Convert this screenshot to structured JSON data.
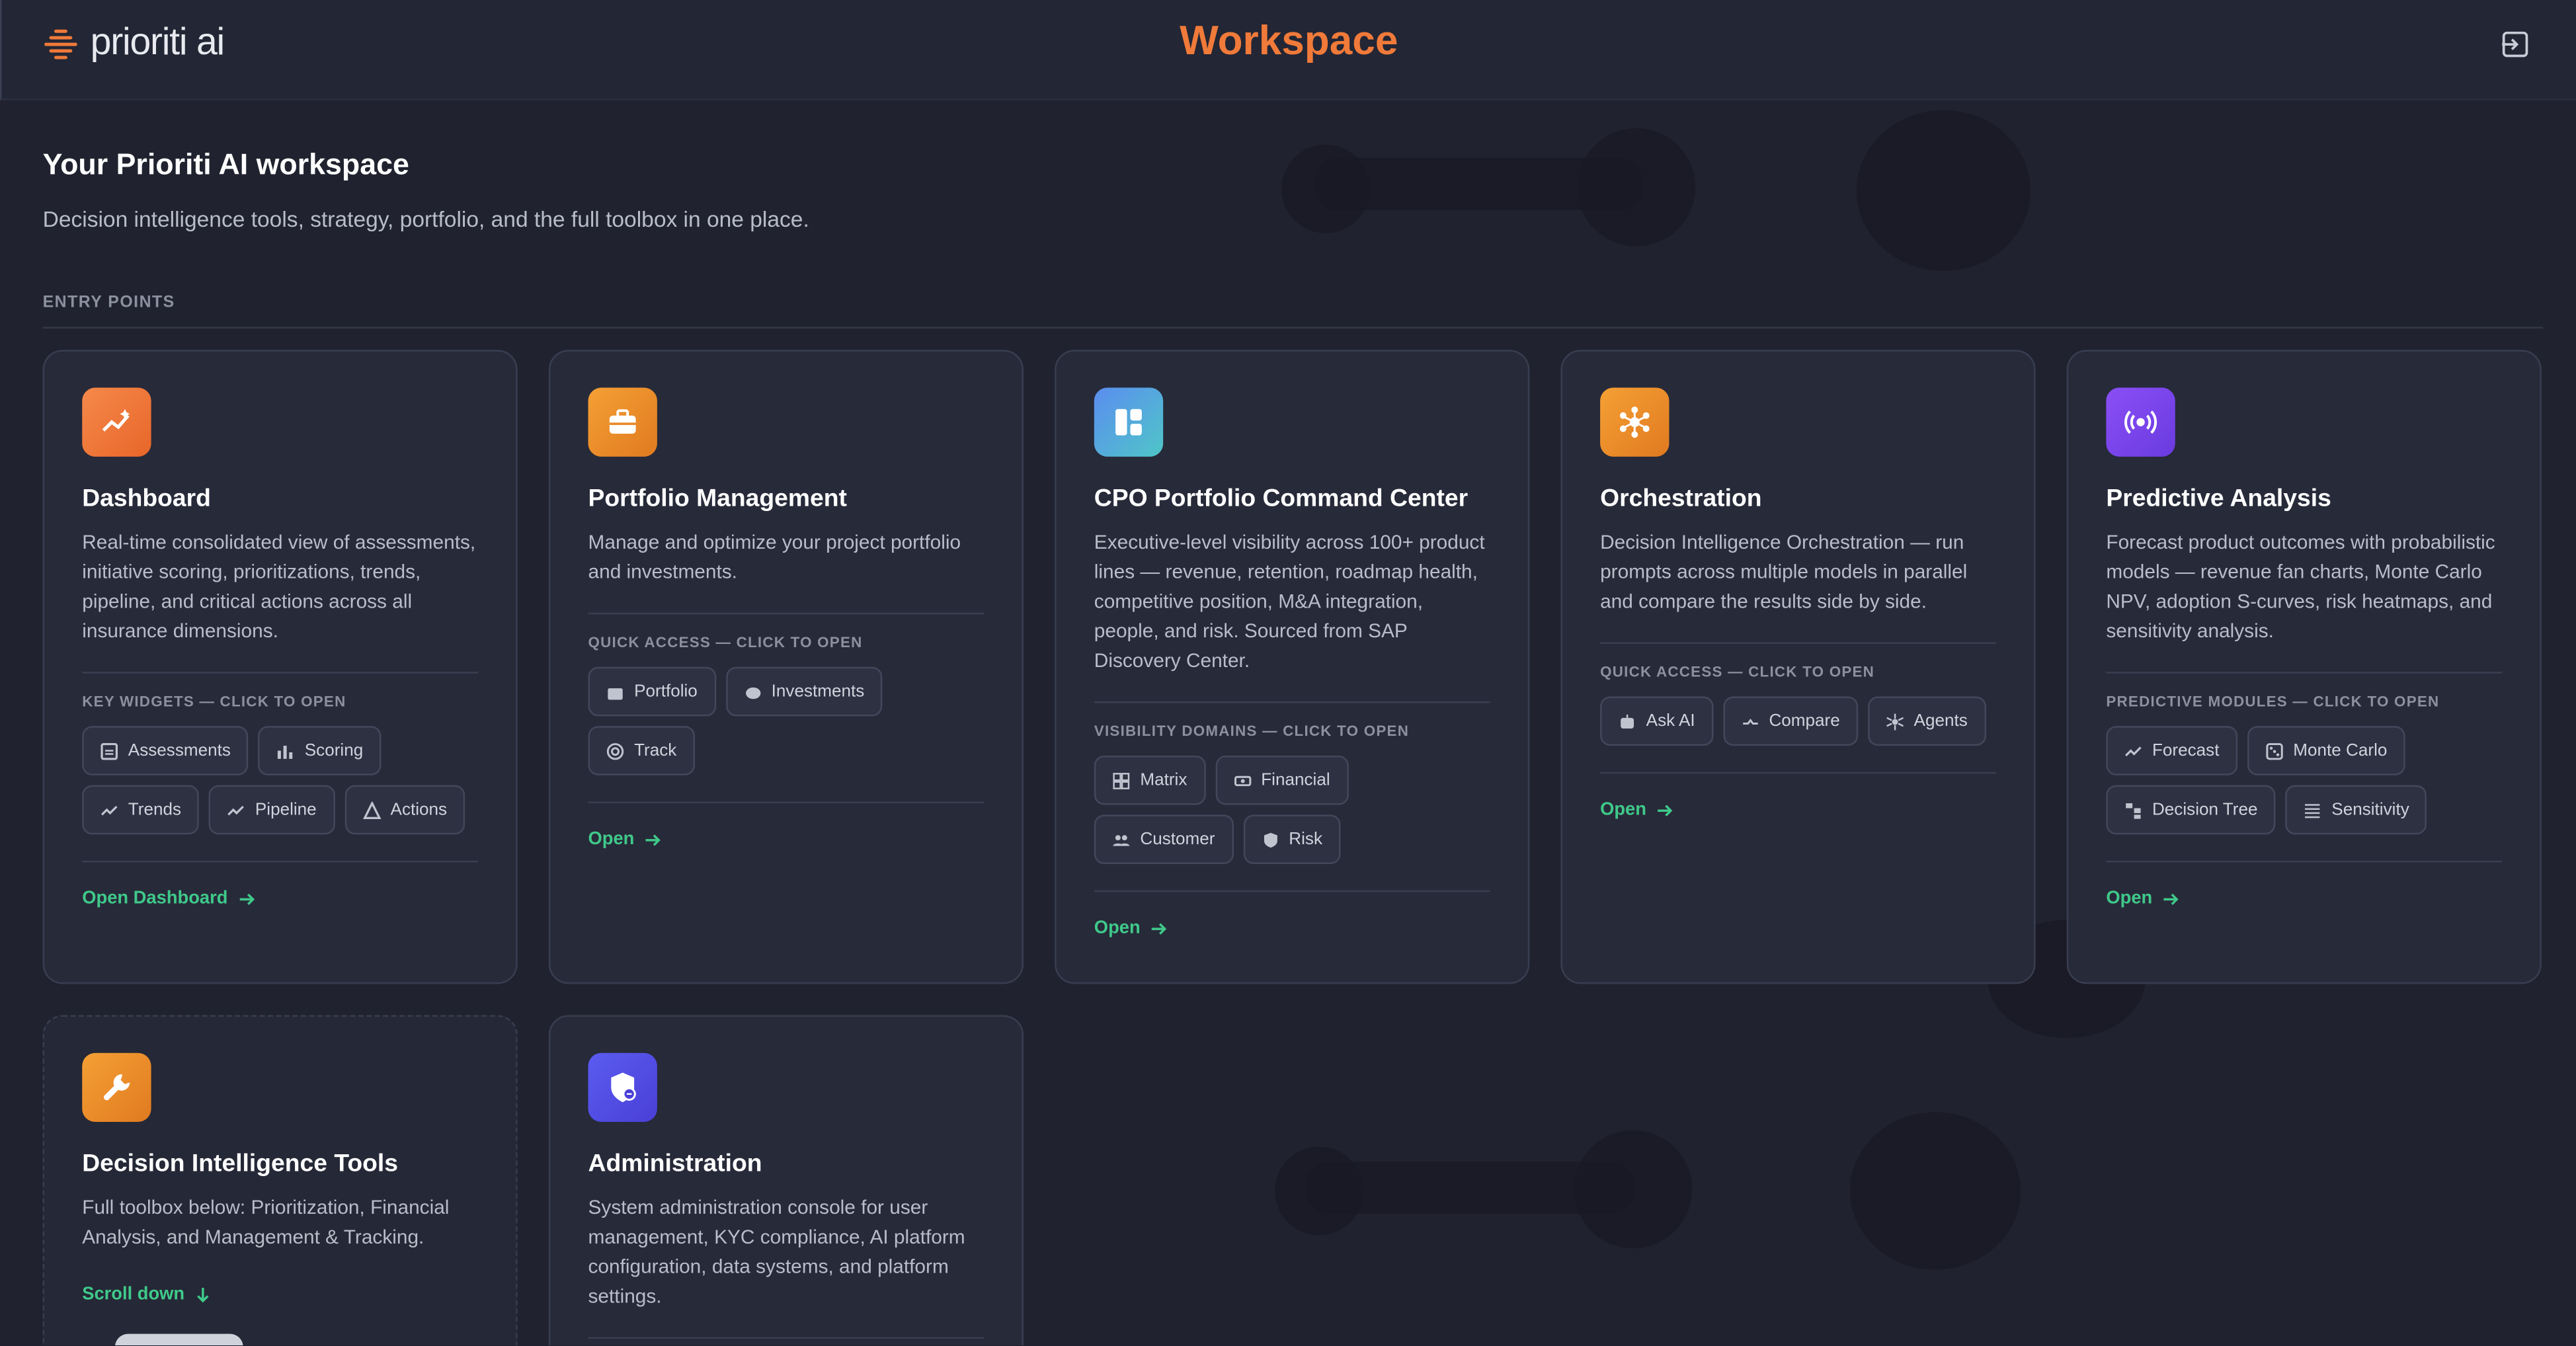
{
  "app": {
    "logo_text": "prioriti ai",
    "title": "Workspace"
  },
  "page": {
    "heading": "Your Prioriti AI workspace",
    "subheading": "Decision intelligence tools, strategy, portfolio, and the full toolbox in one place.",
    "section_label": "ENTRY POINTS"
  },
  "cards": {
    "dashboard": {
      "title": "Dashboard",
      "description": "Real-time consolidated view of assessments, initiative scoring, prioritizations, trends, pipeline, and critical actions across all insurance dimensions.",
      "chips_label": "KEY WIDGETS — CLICK TO OPEN",
      "chips": [
        "Assessments",
        "Scoring",
        "Trends",
        "Pipeline",
        "Actions"
      ],
      "open_label": "Open Dashboard"
    },
    "portfolio": {
      "title": "Portfolio Management",
      "description": "Manage and optimize your project portfolio and investments.",
      "chips_label": "QUICK ACCESS — CLICK TO OPEN",
      "chips": [
        "Portfolio",
        "Investments",
        "Track"
      ],
      "open_label": "Open"
    },
    "cpo": {
      "title": "CPO Portfolio Command Center",
      "description": "Executive-level visibility across 100+ product lines — revenue, retention, roadmap health, competitive position, M&A integration, people, and risk. Sourced from SAP Discovery Center.",
      "chips_label": "VISIBILITY DOMAINS — CLICK TO OPEN",
      "chips": [
        "Matrix",
        "Financial",
        "Customer",
        "Risk"
      ],
      "open_label": "Open"
    },
    "orchestration": {
      "title": "Orchestration",
      "description": "Decision Intelligence Orchestration — run prompts across multiple models in parallel and compare the results side by side.",
      "chips_label": "QUICK ACCESS — CLICK TO OPEN",
      "chips": [
        "Ask AI",
        "Compare",
        "Agents"
      ],
      "open_label": "Open"
    },
    "predictive": {
      "title": "Predictive Analysis",
      "description": "Forecast product outcomes with probabilistic models — revenue fan charts, Monte Carlo NPV, adoption S-curves, risk heatmaps, and sensitivity analysis.",
      "chips_label": "PREDICTIVE MODULES — CLICK TO OPEN",
      "chips": [
        "Forecast",
        "Monte Carlo",
        "Decision Tree",
        "Sensitivity"
      ],
      "open_label": "Open"
    },
    "ditools": {
      "title": "Decision Intelligence Tools",
      "description": "Full toolbox below: Prioritization, Financial Analysis, and Management & Tracking.",
      "open_label": "Scroll down"
    },
    "admin": {
      "title": "Administration",
      "description": "System administration console for user management, KYC compliance, AI platform configuration, data systems, and platform settings."
    }
  },
  "colors": {
    "accent": "#f07a3a",
    "link": "#3fc98a",
    "background": "#20232f",
    "card": "#272a39"
  },
  "icons": {
    "dashboard": "sparkle-chart-icon",
    "portfolio": "briefcase-icon",
    "cpo": "layout-icon",
    "orchestration": "network-icon",
    "predictive": "broadcast-icon",
    "ditools": "wrench-icon",
    "admin": "shield-icon",
    "header_exit": "logout-icon"
  }
}
